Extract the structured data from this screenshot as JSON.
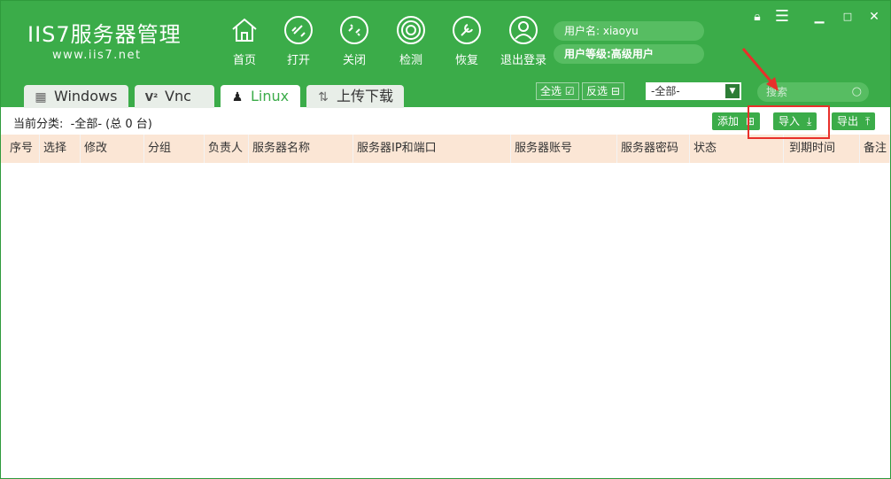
{
  "app": {
    "brand": "IIS7服务器管理",
    "url": "www.iis7.net"
  },
  "toolbar": [
    {
      "label": "首页",
      "icon": "home-icon"
    },
    {
      "label": "打开",
      "icon": "link-icon"
    },
    {
      "label": "关闭",
      "icon": "unlink-icon"
    },
    {
      "label": "检测",
      "icon": "radar-icon"
    },
    {
      "label": "恢复",
      "icon": "wrench-icon"
    },
    {
      "label": "退出登录",
      "icon": "user-icon"
    }
  ],
  "user": {
    "name_label": "用户名:",
    "name": "xiaoyu",
    "level_label": "用户等级:",
    "level": "高级用户"
  },
  "tabs": [
    {
      "label": "Windows",
      "icon": "windows-icon",
      "active": false
    },
    {
      "label": "Vnc",
      "icon": "vnc-icon",
      "active": false
    },
    {
      "label": "Linux",
      "icon": "linux-icon",
      "active": true
    },
    {
      "label": "上传下载",
      "icon": "transfer-icon",
      "active": false
    }
  ],
  "actions": {
    "select_all": "全选",
    "invert": "反选",
    "filter_value": "-全部-",
    "search_placeholder": "搜索",
    "add": "添加",
    "import": "导入",
    "export": "导出"
  },
  "category": {
    "label": "当前分类:",
    "value": "-全部- (总 0 台)"
  },
  "columns": [
    "序号",
    "选择",
    "修改",
    "分组",
    "负责人",
    "服务器名称",
    "服务器IP和端口",
    "服务器账号",
    "服务器密码",
    "状态",
    "到期时间",
    "备注"
  ],
  "colors": {
    "header_green": "#3bac49",
    "table_header": "#fbe6d5",
    "annotation_red": "#e8302a"
  }
}
